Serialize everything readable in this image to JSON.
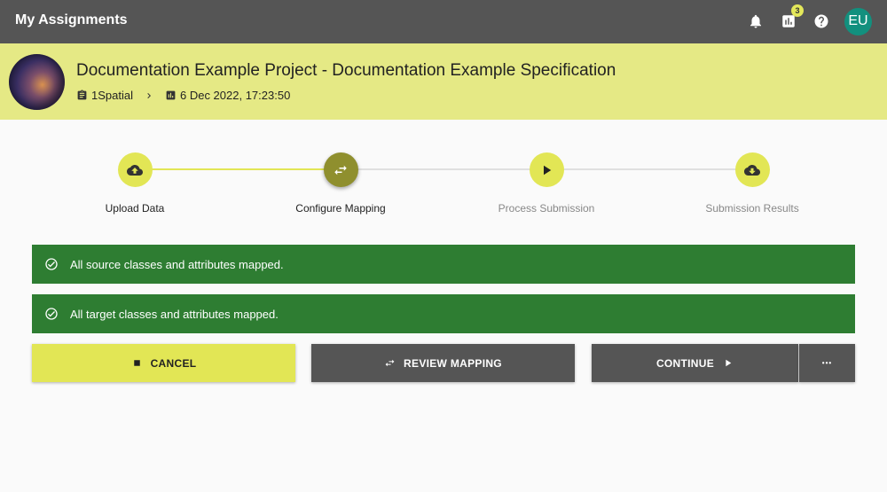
{
  "appbar": {
    "title": "My Assignments",
    "notifications_badge": "3",
    "avatar_initials": "EU"
  },
  "project": {
    "title": "Documentation Example Project - Documentation Example Specification",
    "organisation": "1Spatial",
    "timestamp": "6 Dec 2022, 17:23:50"
  },
  "stepper": {
    "steps": [
      {
        "label": "Upload Data",
        "state": "complete"
      },
      {
        "label": "Configure Mapping",
        "state": "active"
      },
      {
        "label": "Process Submission",
        "state": "pending"
      },
      {
        "label": "Submission Results",
        "state": "pending"
      }
    ]
  },
  "alerts": [
    {
      "text": "All source classes and attributes mapped."
    },
    {
      "text": "All target classes and attributes mapped."
    }
  ],
  "actions": {
    "cancel_label": "CANCEL",
    "review_label": "REVIEW MAPPING",
    "continue_label": "CONTINUE",
    "more_label": "•••"
  },
  "colors": {
    "appbar": "#555555",
    "project_header": "#e5e985",
    "accent": "#e2e655",
    "step_active": "#8f8f2e",
    "success": "#2e7d32",
    "avatar": "#12907e"
  }
}
